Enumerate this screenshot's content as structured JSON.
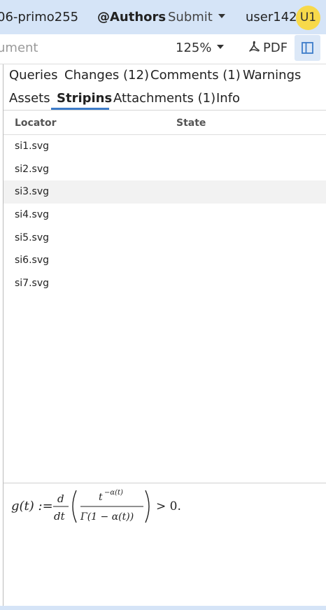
{
  "topbar": {
    "doc_id": "06-primo255",
    "authors": "@Authors",
    "submit": "Submit",
    "user": "user142",
    "avatar": "U1"
  },
  "toolbar": {
    "doc_search": "ument",
    "zoom": "125%",
    "pdf": "PDF"
  },
  "tabs": {
    "row1": [
      "Queries",
      "Changes (12)",
      "Comments (1)",
      "Warnings"
    ],
    "row2": [
      "Assets",
      "Stripins",
      "Attachments (1)",
      "Info"
    ],
    "active": "Stripins"
  },
  "table": {
    "columns": [
      "Locator",
      "State"
    ],
    "rows": [
      {
        "locator": "si1.svg",
        "state": ""
      },
      {
        "locator": "si2.svg",
        "state": ""
      },
      {
        "locator": "si3.svg",
        "state": ""
      },
      {
        "locator": "si4.svg",
        "state": ""
      },
      {
        "locator": "si5.svg",
        "state": ""
      },
      {
        "locator": "si6.svg",
        "state": ""
      },
      {
        "locator": "si7.svg",
        "state": ""
      }
    ],
    "highlighted_row": "si3.svg"
  },
  "formula": {
    "lhs": "g(t) :=",
    "d_num": "d",
    "d_den": "dt",
    "frac_num": "t",
    "frac_num_exp": "−α(t)",
    "frac_den": "Γ(1 − α(t))",
    "rhs": "> 0."
  },
  "colors": {
    "topbar_bg": "#d5e4f7",
    "avatar_bg": "#f7d94a",
    "accent": "#3d7cc9"
  },
  "icons": {
    "pdf": "acrobat-icon",
    "sidebar_toggle": "sidebar-panel-icon",
    "dropdown": "caret-down-icon"
  }
}
